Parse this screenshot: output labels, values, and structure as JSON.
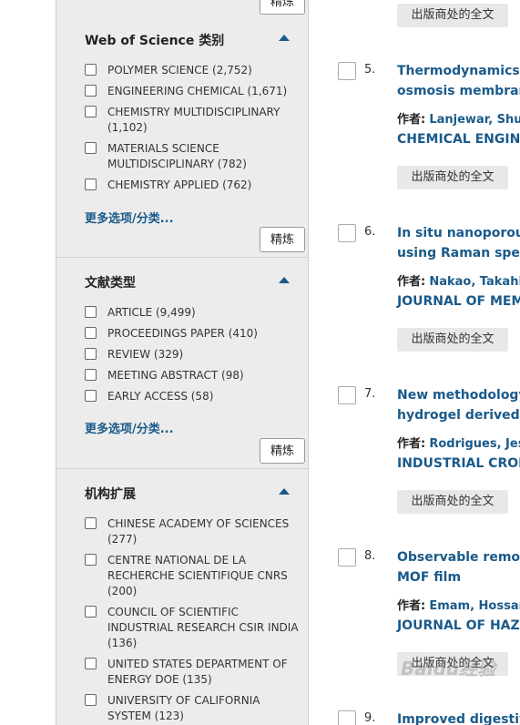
{
  "sidebar": {
    "top_refine": "精炼",
    "wos": {
      "title": "Web of Science 类别",
      "items": [
        {
          "label": "POLYMER SCIENCE (2,752)"
        },
        {
          "label": "ENGINEERING CHEMICAL (1,671)"
        },
        {
          "label": "CHEMISTRY MULTIDISCIPLINARY (1,102)"
        },
        {
          "label": "MATERIALS SCIENCE MULTIDISCIPLINARY (782)"
        },
        {
          "label": "CHEMISTRY APPLIED (762)"
        }
      ],
      "more": "更多选项/分类...",
      "refine": "精炼"
    },
    "doctype": {
      "title": "文献类型",
      "items": [
        {
          "label": "ARTICLE (9,499)"
        },
        {
          "label": "PROCEEDINGS PAPER (410)"
        },
        {
          "label": "REVIEW (329)"
        },
        {
          "label": "MEETING ABSTRACT (98)"
        },
        {
          "label": "EARLY ACCESS (58)"
        }
      ],
      "more": "更多选项/分类...",
      "refine": "精炼"
    },
    "org": {
      "title": "机构扩展",
      "items": [
        {
          "label": "CHINESE ACADEMY OF SCIENCES (277)"
        },
        {
          "label": "CENTRE NATIONAL DE LA RECHERCHE SCIENTIFIQUE CNRS (200)"
        },
        {
          "label": "COUNCIL OF SCIENTIFIC INDUSTRIAL RESEARCH CSIR INDIA (136)"
        },
        {
          "label": "UNITED STATES DEPARTMENT OF ENERGY DOE (135)"
        },
        {
          "label": "UNIVERSITY OF CALIFORNIA SYSTEM (123)"
        }
      ]
    }
  },
  "results": {
    "publisher_label": "出版商处的全文",
    "author_key": "作者:",
    "items": [
      {
        "num": "5.",
        "title1": "Thermodynamics of",
        "title2": "osmosis membrane:",
        "authors": "Lanjewar, Shubh",
        "source": "CHEMICAL ENGINEERI"
      },
      {
        "num": "6.",
        "title1": "In situ nanoporous st",
        "title2": "using Raman spectro",
        "authors": "Nakao, Takahito;",
        "source": "JOURNAL OF MEMBR"
      },
      {
        "num": "7.",
        "title1": "New methodology fo",
        "title2": "hydrogel derived fro",
        "authors": "Rodrigues, Jessic",
        "source": "INDUSTRIAL CROPS A"
      },
      {
        "num": "8.",
        "title1": "Observable removal",
        "title2": "MOF film",
        "authors": "Emam, Hossam E",
        "source": "JOURNAL OF HAZARI"
      },
      {
        "num": "9.",
        "title1": "Improved digestive s"
      }
    ]
  },
  "watermark": "Baidu经验"
}
